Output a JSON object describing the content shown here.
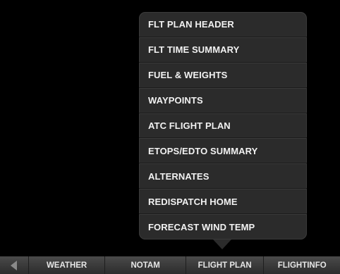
{
  "menu": {
    "items": [
      {
        "label": "FLT PLAN HEADER"
      },
      {
        "label": "FLT TIME SUMMARY"
      },
      {
        "label": "FUEL & WEIGHTS"
      },
      {
        "label": "WAYPOINTS"
      },
      {
        "label": "ATC FLIGHT PLAN"
      },
      {
        "label": "ETOPS/EDTO SUMMARY"
      },
      {
        "label": "ALTERNATES"
      },
      {
        "label": "REDISPATCH HOME"
      },
      {
        "label": "FORECAST WIND TEMP"
      }
    ]
  },
  "tabbar": {
    "back_icon": "left-triangle",
    "tabs": [
      {
        "label": "WEATHER"
      },
      {
        "label": "NOTAM"
      },
      {
        "label": "FLIGHT PLAN"
      },
      {
        "label": "FLIGHTINFO"
      }
    ]
  }
}
